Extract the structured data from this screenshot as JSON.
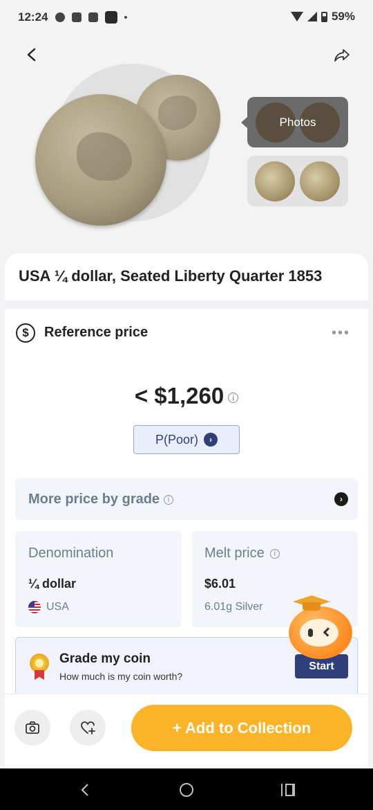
{
  "status_bar": {
    "time": "12:24",
    "battery": "59%"
  },
  "header": {
    "back_icon": "chevron-left-icon",
    "share_icon": "share-arrow-icon"
  },
  "gallery": {
    "photos_label": "Photos"
  },
  "coin": {
    "title": "USA ¼ dollar, Seated Liberty Quarter 1853"
  },
  "reference_price": {
    "title": "Reference price",
    "more_icon": "more-horizontal-icon",
    "price": "< $1,260",
    "grade_label": "P(Poor)"
  },
  "more_by_grade": {
    "label": "More price by grade"
  },
  "denomination": {
    "label": "Denomination",
    "value": "¼ dollar",
    "country": "USA"
  },
  "melt_price": {
    "label": "Melt price",
    "value": "$6.01",
    "detail": "6.01g Silver"
  },
  "grade_promo": {
    "title": "Grade my coin",
    "subtitle": "How much is my coin worth?",
    "button": "Start"
  },
  "actions": {
    "add_label": "+ Add to Collection"
  },
  "colors": {
    "accent_orange": "#fbb428",
    "navy": "#2f3f7a"
  }
}
